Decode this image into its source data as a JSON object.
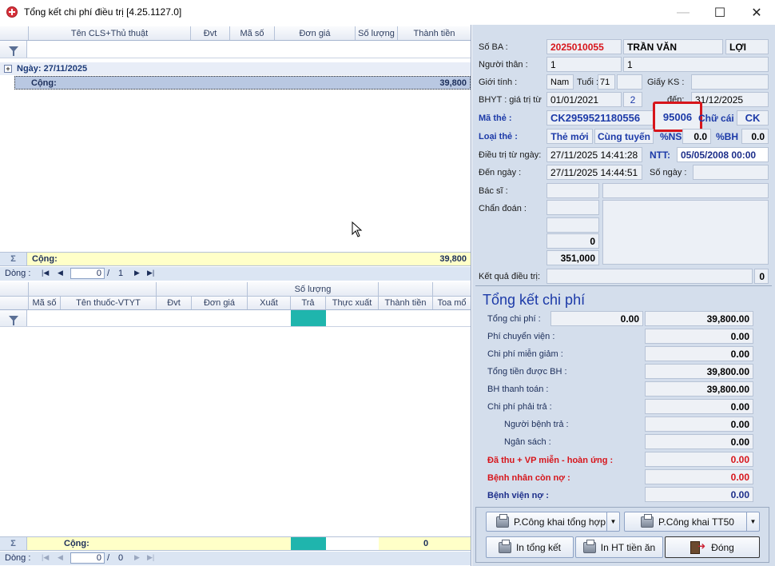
{
  "window": {
    "title": "Tổng kết chi phí điều trị [4.25.1127.0]",
    "min_label": "—",
    "max_label": "☐",
    "close_label": "✕"
  },
  "cls_grid": {
    "columns": [
      "Tên CLS+Thủ thuật",
      "Đvt",
      "Mã số",
      "Đơn giá",
      "Số lượng",
      "Thành tiền"
    ],
    "group_label": "Ngày:  27/11/2025",
    "group_toggle": "+",
    "subtotal_label": "Cộng:",
    "subtotal_value": "39,800",
    "footer_sigma": "Σ",
    "footer_label": "Cộng:",
    "footer_value": "39,800",
    "nav": {
      "label": "Dòng :",
      "current": "0",
      "sep": "/",
      "total": "1"
    }
  },
  "drug_grid": {
    "group_header": "Số lượng",
    "columns": [
      "Mã số",
      "Tên thuốc-VTYT",
      "Đvt",
      "Đơn giá",
      "Xuất",
      "Trả",
      "Thực xuất",
      "Thành tiền",
      "Toa mổ"
    ],
    "footer_sigma": "Σ",
    "footer_label": "Cộng:",
    "footer_value": "0",
    "nav": {
      "label": "Dòng :",
      "current": "0",
      "sep": "/",
      "total": "0"
    }
  },
  "patient": {
    "so_ba_label": "Số BA :",
    "so_ba": "2025010055",
    "ho": "TRẦN VĂN",
    "ten": "LỢI",
    "nguoi_than_label": "Người thân :",
    "nguoi_than_1": "1",
    "nguoi_than_2": "1",
    "gioi_tinh_label": "Giới tính :",
    "gioi_tinh": "Nam",
    "tuoi_label": "Tuổi :",
    "tuoi": "71",
    "giay_ks_label": "Giấy KS :",
    "giay_ks": "",
    "bhyt_label": "BHYT : giá trị từ",
    "bhyt_tu": "01/01/2021",
    "bhyt_so": "2",
    "den_label": "đến:",
    "bhyt_den": "31/12/2025",
    "ma_the_label": "Mã thẻ :",
    "ma_the": "CK2959521180556",
    "ma_dk": "95006",
    "chu_cai_label": "Chữ cái",
    "chu_cai": "CK",
    "loai_the_label": "Loại thẻ :",
    "loai_the": "Thẻ mới",
    "tuyen": "Cùng tuyến",
    "ns_label": "%NS",
    "ns": "0.0",
    "bh_label": "%BH",
    "bh": "0.0",
    "dieu_tri_tu_label": "Điều trị từ ngày:",
    "dieu_tri_tu": "27/11/2025 14:41:28",
    "ntt_label": "NTT:",
    "ntt": "05/05/2008 00:00",
    "den_ngay_label": "Đến ngày :",
    "den_ngay": "27/11/2025 14:44:51",
    "so_ngay_label": "Số ngày :",
    "so_ngay": "",
    "bac_si_label": "Bác sĩ :",
    "chan_doan_label": "Chẩn đoán :",
    "val_0": "0",
    "val_351": "351,000",
    "ket_qua_label": "Kết quả điều trị:",
    "ket_qua": "0"
  },
  "summary": {
    "title": "Tổng kết chi phí",
    "rows": [
      {
        "label": "Tổng chi phí :",
        "left": "0.00",
        "value": "39,800.00"
      },
      {
        "label": "Phí chuyển viện :",
        "value": "0.00"
      },
      {
        "label": "Chi phí miễn giảm :",
        "value": "0.00"
      },
      {
        "label": "Tổng tiền được BH :",
        "value": "39,800.00"
      },
      {
        "label": "BH thanh toán :",
        "value": "39,800.00"
      },
      {
        "label": "Chi phí phải trả :",
        "value": "0.00"
      },
      {
        "label": "Người bệnh trả :",
        "value": "0.00"
      },
      {
        "label": "Ngân sách :",
        "value": "0.00"
      },
      {
        "label": "Đã thu + VP miễn - hoàn ứng :",
        "value": "0.00"
      },
      {
        "label": "Bệnh nhân còn nợ :",
        "value": "0.00"
      },
      {
        "label": "Bệnh viện nợ :",
        "value": "0.00"
      }
    ]
  },
  "buttons": {
    "cong_khai_tong_hop": "P.Công khai tổng hợp",
    "cong_khai_tt50": "P.Công khai TT50",
    "in_tong_ket": "In tổng kết",
    "in_ht_tien_an": "In HT tiền ăn",
    "dong": "Đóng",
    "dropdown": "▼"
  },
  "colors": {
    "accent": "#1c3aa8",
    "danger": "#d7151b",
    "panel": "#d4deec",
    "sum_row": "#ffffc8"
  }
}
